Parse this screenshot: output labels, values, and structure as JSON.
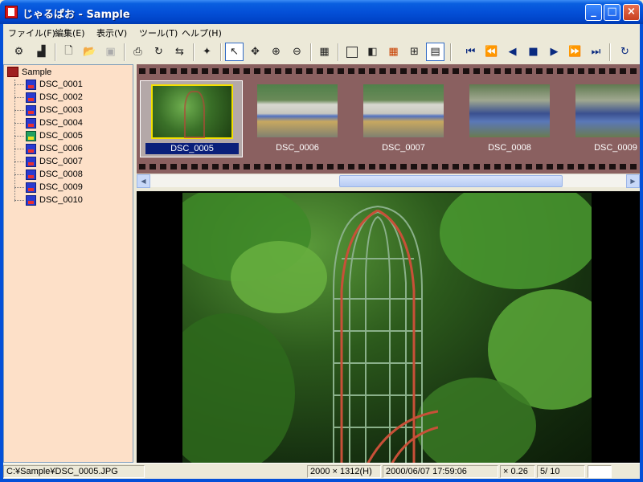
{
  "window": {
    "title": "じゃるぱお - Sample",
    "min": "_",
    "max": "□",
    "close": "×"
  },
  "menu": [
    "ファイル(F)",
    "編集(E)",
    "表示(V)",
    "ツール(T)",
    "ヘルプ(H)"
  ],
  "tree": {
    "root": "Sample",
    "items": [
      "DSC_0001",
      "DSC_0002",
      "DSC_0003",
      "DSC_0004",
      "DSC_0005",
      "DSC_0006",
      "DSC_0007",
      "DSC_0008",
      "DSC_0009",
      "DSC_0010"
    ],
    "selected": "DSC_0005"
  },
  "filmstrip": {
    "thumbs": [
      {
        "label": "DSC_0005",
        "selected": true
      },
      {
        "label": "DSC_0006"
      },
      {
        "label": "DSC_0007"
      },
      {
        "label": "DSC_0008"
      },
      {
        "label": "DSC_0009"
      }
    ]
  },
  "status": {
    "path": "C:¥Sample¥DSC_0005.JPG",
    "dimensions": "2000 × 1312(H)",
    "datetime": "2000/06/07 17:59:06",
    "zoom": "× 0.26",
    "position": "5/  10"
  },
  "colors": {
    "tree_bg": "#fde0c8",
    "film_bg": "#8a6060",
    "title_blue": "#0450d8"
  }
}
